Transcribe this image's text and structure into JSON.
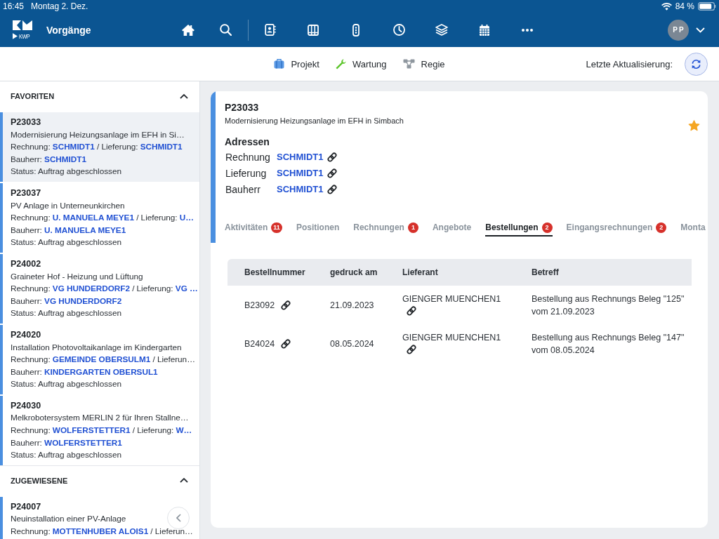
{
  "status_bar": {
    "time": "16:45",
    "date": "Montag 2. Dez.",
    "battery": "84 %"
  },
  "header": {
    "logo_text": "KWP",
    "title": "Vorgänge",
    "avatar_initials": "PP"
  },
  "subnav": {
    "links": [
      {
        "label": "Projekt",
        "kind": "project"
      },
      {
        "label": "Wartung",
        "kind": "maintenance"
      },
      {
        "label": "Regie",
        "kind": "direct"
      }
    ],
    "update_label": "Letzte Aktualisierung:"
  },
  "sidebar": {
    "sections": [
      {
        "title": "FAVORITEN",
        "expanded": true,
        "items": [
          {
            "number": "P23033",
            "title": "Modernisierung Heizungsanlage im EFH in Si…",
            "addresses": "Rechnung: **SCHMIDT1** / Lieferung: **SCHMIDT1**",
            "builder": "Bauherr: **SCHMIDT1**",
            "status": "Status: Auftrag abgeschlossen",
            "selected": true
          },
          {
            "number": "P23037",
            "title": "PV Anlage in Unterneunkirchen",
            "addresses": "Rechnung: **U. MANUELA MEYE1** / Lieferung: **U…**",
            "builder": "Bauherr: **U. MANUELA MEYE1**",
            "status": "Status: Auftrag abgeschlossen",
            "selected": false
          },
          {
            "number": "P24002",
            "title": "Graineter Hof - Heizung und Lüftung",
            "addresses": "Rechnung: **VG HUNDERDORF2** / Lieferung: **VG …**",
            "builder": "Bauherr: **VG HUNDERDORF2**",
            "status": "Status: Auftrag abgeschlossen",
            "selected": false
          },
          {
            "number": "P24020",
            "title": "Installation Photovoltaikanlage im Kindergarten",
            "addresses": "Rechnung: **GEMEINDE OBERSULM1** / Lieferun…",
            "builder": "Bauherr: **KINDERGARTEN OBERSUL1**",
            "status": "Status: Auftrag abgeschlossen",
            "selected": false
          },
          {
            "number": "P24030",
            "title": "Melkrobotersystem MERLIN 2 für Ihren Stallne…",
            "addresses": "Rechnung: **WOLFERSTETTER1** / Lieferung: **W…**",
            "builder": "Bauherr: **WOLFERSTETTER1**",
            "status": "Status: Auftrag abgeschlossen",
            "selected": false
          }
        ]
      },
      {
        "title": "ZUGEWIESENE",
        "expanded": true,
        "items": [
          {
            "number": "P24007",
            "title": "Neuinstallation einer PV-Anlage",
            "addresses": "Rechnung: **MOTTENHUBER ALOIS1** / Lieferun…",
            "selected": false
          }
        ]
      }
    ]
  },
  "detail": {
    "number": "P23033",
    "title": "Modernisierung Heizungsanlage im EFH in Simbach",
    "favorite": true,
    "addresses_heading": "Adressen",
    "addresses": [
      {
        "label": "Rechnung",
        "value": "SCHMIDT1"
      },
      {
        "label": "Lieferung",
        "value": "SCHMIDT1"
      },
      {
        "label": "Bauherr",
        "value": "SCHMIDT1"
      }
    ],
    "tabs": [
      {
        "label": "Aktivitäten",
        "badge": "11",
        "selected": false
      },
      {
        "label": "Positionen",
        "selected": false
      },
      {
        "label": "Rechnungen",
        "badge": "1",
        "selected": false
      },
      {
        "label": "Angebote",
        "selected": false
      },
      {
        "label": "Bestellungen",
        "badge": "2",
        "selected": true
      },
      {
        "label": "Eingangsrechnungen",
        "badge": "2",
        "selected": false
      },
      {
        "label": "Monta",
        "selected": false
      }
    ],
    "table": {
      "columns": [
        "Bestellnummer",
        "gedruck am",
        "Lieferant",
        "Betreff"
      ],
      "rows": [
        {
          "order_number": "B23092",
          "printed_on": "21.09.2023",
          "supplier": "GIENGER MUENCHEN1",
          "subject": "Bestellung aus Rechnungs Beleg \"125\" vom 21.09.2023"
        },
        {
          "order_number": "B24024",
          "printed_on": "08.05.2024",
          "supplier": "GIENGER MUENCHEN1",
          "subject": "Bestellung aus Rechnungs Beleg \"147\" vom 08.05.2024"
        }
      ]
    }
  }
}
